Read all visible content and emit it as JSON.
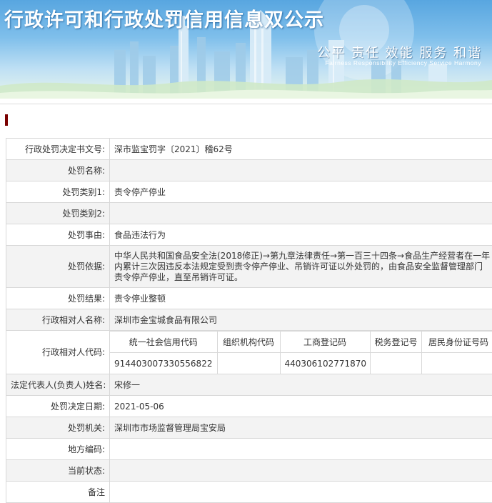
{
  "header": {
    "title": "行政许可和行政处罚信用信息双公示",
    "slogan": "公平 责任 效能 服务 和谐",
    "slogan_en": "Fairness Responsibility Efficiency Service Harmony"
  },
  "record": {
    "rows": [
      {
        "label": "行政处罚决定书文号:",
        "value": "深市监宝罚字〔2021〕稽62号"
      },
      {
        "label": "处罚名称:",
        "value": ""
      },
      {
        "label": "处罚类别1:",
        "value": "责令停产停业"
      },
      {
        "label": "处罚类别2:",
        "value": ""
      },
      {
        "label": "处罚事由:",
        "value": "食品违法行为"
      },
      {
        "label": "处罚依据:",
        "value": "中华人民共和国食品安全法(2018修正)→第九章法律责任→第一百三十四条→食品生产经营者在一年内累计三次因违反本法规定受到责令停产停业、吊销许可证以外处罚的，由食品安全监督管理部门责令停产停业，直至吊销许可证。"
      },
      {
        "label": "处罚结果:",
        "value": "责令停业整顿"
      },
      {
        "label": "行政相对人名称:",
        "value": "深圳市金宝城食品有限公司"
      }
    ],
    "codes": {
      "label": "行政相对人代码:",
      "headers": [
        "统一社会信用代码",
        "组织机构代码",
        "工商登记码",
        "税务登记号",
        "居民身份证号码"
      ],
      "values": [
        "914403007330556822",
        "",
        "440306102771870",
        "",
        ""
      ]
    },
    "rows2": [
      {
        "label": "法定代表人(负责人)姓名:",
        "value": "宋修一"
      },
      {
        "label": "处罚决定日期:",
        "value": "2021-05-06"
      },
      {
        "label": "处罚机关:",
        "value": "深圳市市场监督管理局宝安局"
      },
      {
        "label": "地方编码:",
        "value": ""
      },
      {
        "label": "当前状态:",
        "value": ""
      },
      {
        "label": "备注",
        "value": ""
      }
    ]
  },
  "colors": {
    "accent": "#7a0000",
    "sky": "#58a6e0",
    "border": "#d8d8d8",
    "row_alt": "#f3f3f3"
  }
}
